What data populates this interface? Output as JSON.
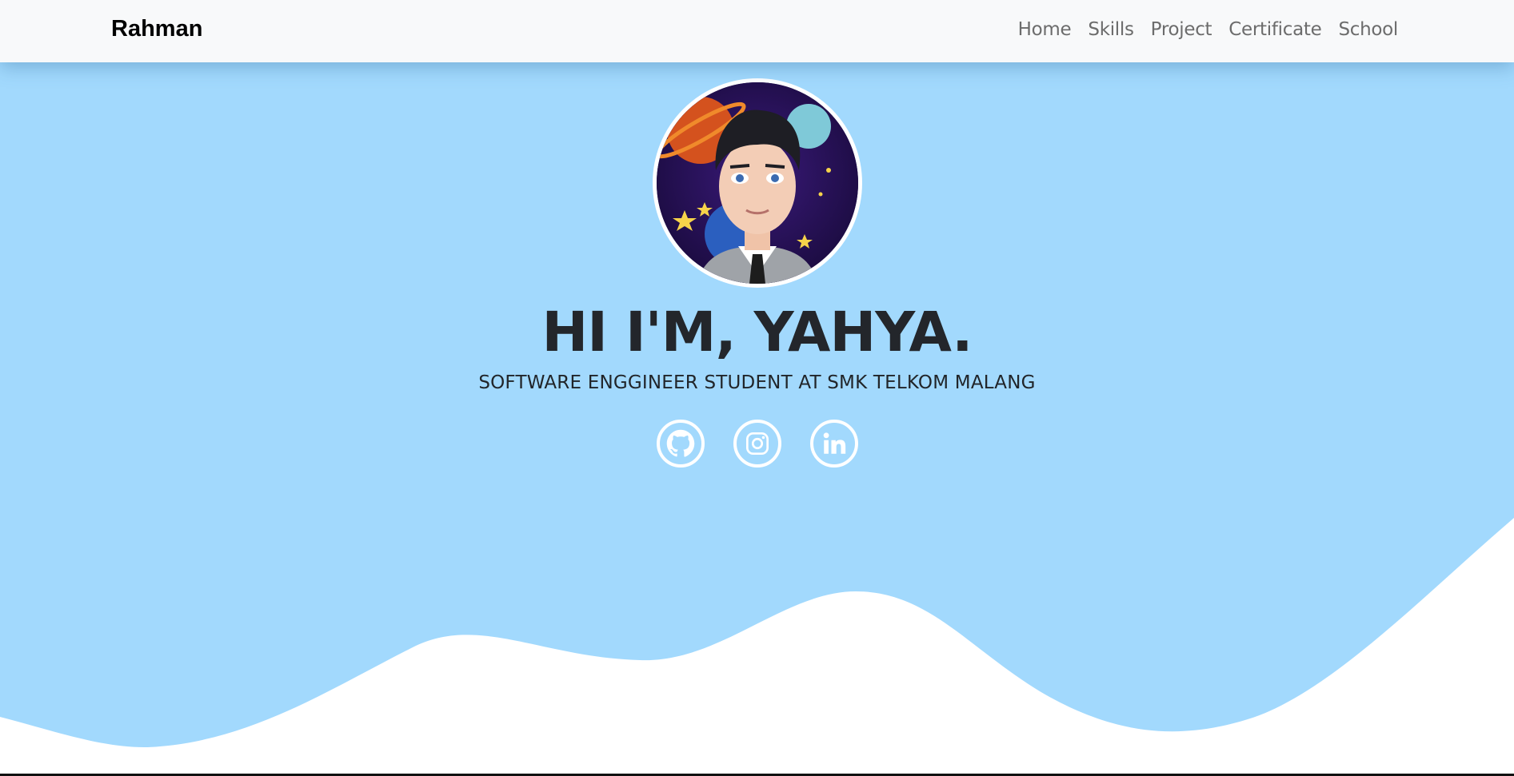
{
  "navbar": {
    "brand": "Rahman",
    "links": [
      "Home",
      "Skills",
      "Project",
      "Certificate",
      "School"
    ]
  },
  "hero": {
    "title": "HI I'M, YAHYA.",
    "subtitle": "SOFTWARE ENGGINEER STUDENT AT SMK TELKOM MALANG",
    "avatar_icon": "avatar-portrait-icon",
    "socials": [
      {
        "name": "github",
        "icon": "github-icon"
      },
      {
        "name": "instagram",
        "icon": "instagram-icon"
      },
      {
        "name": "linkedin",
        "icon": "linkedin-icon"
      }
    ]
  },
  "colors": {
    "hero_background": "#a2d9fd",
    "navbar_background": "#f8f9fa",
    "text_dark": "#23262b",
    "nav_link": "#6c6c6c",
    "icon_border": "#ffffff"
  }
}
